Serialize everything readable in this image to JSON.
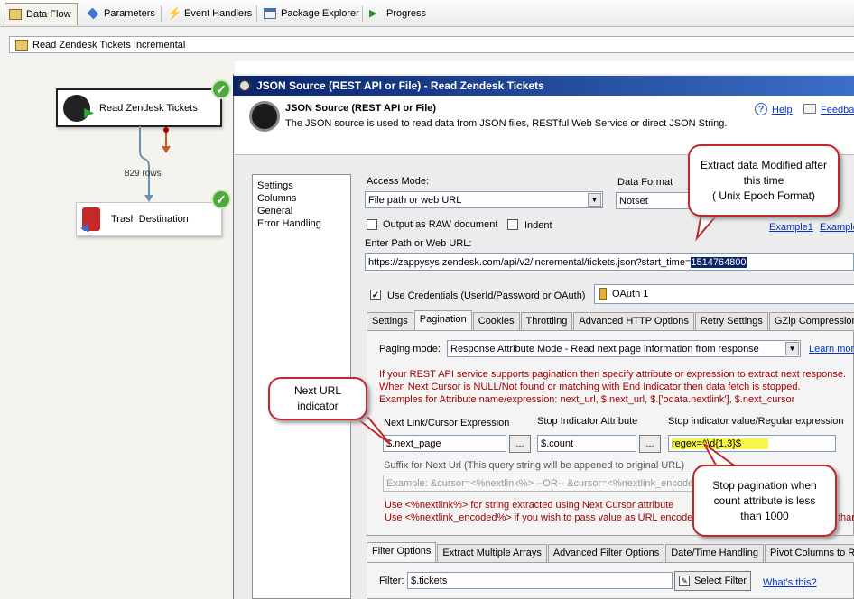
{
  "toolbar": {
    "tabs": [
      {
        "label": "Data Flow",
        "icon": "data-flow-icon"
      },
      {
        "label": "Parameters",
        "icon": "parameters-icon"
      },
      {
        "label": "Event Handlers",
        "icon": "event-handlers-icon"
      },
      {
        "label": "Package Explorer",
        "icon": "package-explorer-icon"
      },
      {
        "label": "Progress",
        "icon": "progress-icon"
      }
    ]
  },
  "path": {
    "value": "Read Zendesk Tickets Incremental"
  },
  "canvas": {
    "source_task": "Read Zendesk Tickets",
    "rows_label": "829 rows",
    "dest_task": "Trash Destination"
  },
  "dialog": {
    "title": "JSON Source (REST API or File) - Read Zendesk Tickets",
    "header_title": "JSON Source (REST API or File)",
    "header_desc": "The JSON source is used to read data from JSON files, RESTful Web Service or direct JSON String.",
    "help": "Help",
    "feedback": "Feedba"
  },
  "nav": {
    "items": [
      "Settings",
      "Columns",
      "General",
      "Error Handling"
    ]
  },
  "settings": {
    "access_mode_label": "Access Mode:",
    "access_mode_value": "File path or web URL",
    "data_format_label": "Data Format",
    "data_format_value": "Notset",
    "raw_label": "Output as RAW document",
    "indent_label": "Indent",
    "example1": "Example1",
    "example2": "Example",
    "url_label": "Enter Path or Web URL:",
    "url_prefix": "https://zappysys.zendesk.com/api/v2/incremental/tickets.json?start_time=",
    "url_highlight": "1514764800",
    "use_cred_label": "Use Credentials (UserId/Password or OAuth)",
    "connection_value": "OAuth 1"
  },
  "tabs": [
    "Settings",
    "Pagination",
    "Cookies",
    "Throttling",
    "Advanced HTTP Options",
    "Retry Settings",
    "GZip Compression",
    "A"
  ],
  "pagination": {
    "mode_label": "Paging mode:",
    "mode_value": "Response Attribute Mode - Read next page information from response",
    "learn_more": "Learn mor",
    "info1": "If your REST API service supports pagination then specify attribute or expression to extract next response.",
    "info2": "When Next Cursor is NULL/Not found or matching with End Indicator then data fetch is stopped.",
    "info3": "Examples for Attribute name/expression:  next_url, $.next_url,  $.['odata.nextlink'], $.next_cursor",
    "next_link_label": "Next Link/Cursor Expression",
    "next_link_value": "$.next_page",
    "stop_attr_label": "Stop Indicator Attribute",
    "stop_attr_value": "$.count",
    "stop_regex_label": "Stop indicator value/Regular expression",
    "stop_regex_value": "regex=^\\d{1,3}$",
    "browse": "...",
    "suffix_label": "Suffix for Next Url  (This query string will be appened to original URL)",
    "suffix_placeholder": "Example:  &cursor=<%nextlink%> --OR--  &cursor=<%nextlink_encode",
    "hint1": "Use <%nextlink%> for string extracted using Next Cursor attribute",
    "hint2": "Use <%nextlink_encoded%> if you wish to pass value as URL encode",
    "hint2_tail": "thar"
  },
  "filter_tabs": [
    "Filter Options",
    "Extract Multiple Arrays",
    "Advanced Filter Options",
    "Date/Time Handling",
    "Pivot Columns to Row"
  ],
  "filter": {
    "label": "Filter:",
    "value": "$.tickets",
    "select_btn": "Select Filter",
    "whats_this": "What's this?"
  },
  "callouts": {
    "epoch": [
      "Extract data Modified after",
      "this time",
      "( Unix Epoch Format)"
    ],
    "next_url": [
      "Next URL",
      "indicator"
    ],
    "stop": [
      "Stop pagination when",
      "count attribute is less",
      "than 1000"
    ]
  },
  "colors": {
    "accent_red": "#c0282c",
    "title_blue": "#0a246a",
    "highlight": "#f6f64a",
    "success_green": "#4fa83b"
  }
}
